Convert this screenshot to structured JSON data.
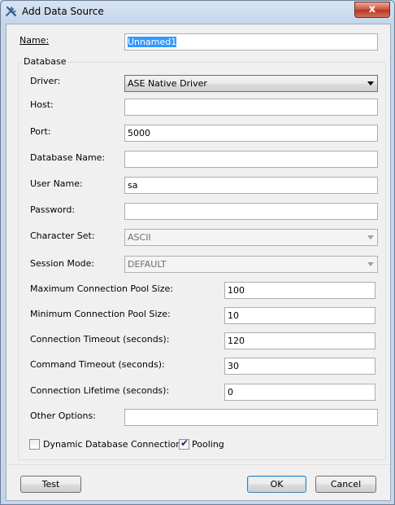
{
  "window": {
    "title": "Add Data Source",
    "close_glyph": "x",
    "icon": "tools-icon"
  },
  "name": {
    "label": "Name:",
    "value": "Unnamed1"
  },
  "database_group": {
    "title": "Database"
  },
  "driver": {
    "label": "Driver:",
    "value": "ASE Native Driver"
  },
  "host": {
    "label": "Host:",
    "value": ""
  },
  "port": {
    "label": "Port:",
    "value": "5000"
  },
  "database_name": {
    "label": "Database Name:",
    "value": ""
  },
  "user_name": {
    "label": "User Name:",
    "value": "sa"
  },
  "password": {
    "label": "Password:",
    "value": ""
  },
  "character_set": {
    "label": "Character Set:",
    "value": "ASCII"
  },
  "session_mode": {
    "label": "Session Mode:",
    "value": "DEFAULT"
  },
  "max_pool": {
    "label": "Maximum Connection Pool Size:",
    "value": "100"
  },
  "min_pool": {
    "label": "Minimum Connection Pool Size:",
    "value": "10"
  },
  "conn_timeout": {
    "label": "Connection Timeout (seconds):",
    "value": "120"
  },
  "cmd_timeout": {
    "label": "Command Timeout (seconds):",
    "value": "30"
  },
  "conn_lifetime": {
    "label": "Connection Lifetime (seconds):",
    "value": "0"
  },
  "other_options": {
    "label": "Other Options:",
    "value": ""
  },
  "dynamic_db": {
    "label": "Dynamic Database Connection",
    "checked": false
  },
  "pooling": {
    "label": "Pooling",
    "checked": true
  },
  "buttons": {
    "test": "Test",
    "ok": "OK",
    "cancel": "Cancel"
  }
}
